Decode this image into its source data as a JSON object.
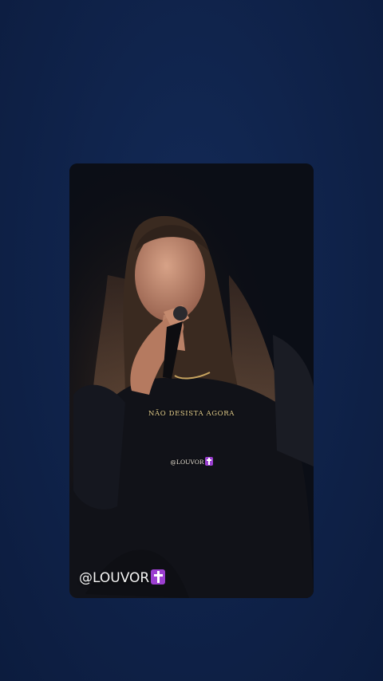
{
  "video": {
    "lyric": "NÃO DESISTA AGORA",
    "small_watermark": "@LOUVOR",
    "big_watermark": "@LOUVOR",
    "watermark_icon": "purple-cross-icon"
  },
  "colors": {
    "background": "#0f2148",
    "lyric_text": "#e4cf8f",
    "cross_badge": "#9b3fd0"
  }
}
